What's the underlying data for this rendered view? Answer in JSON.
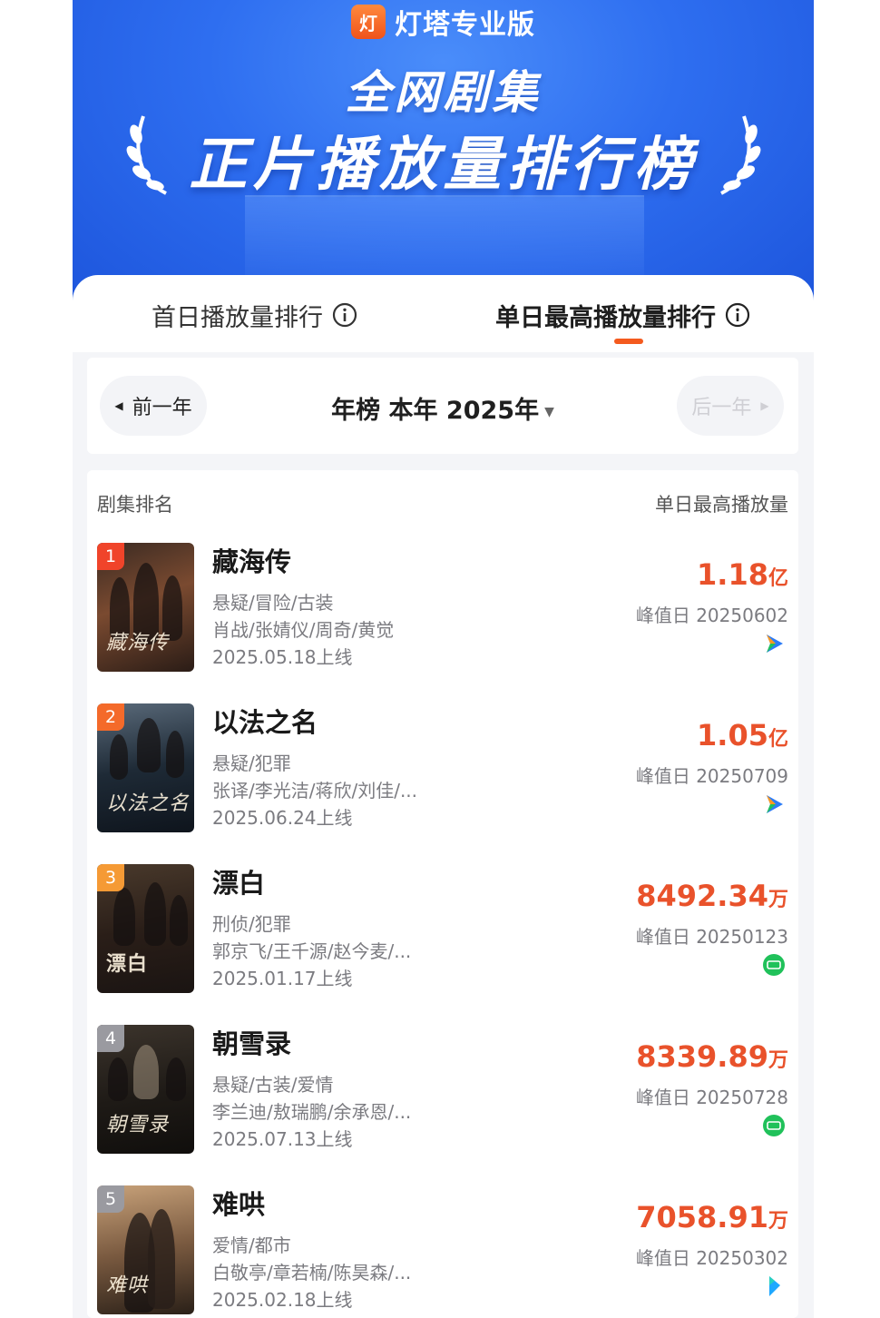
{
  "header": {
    "brand": "灯塔专业版",
    "brand_logo_char": "灯",
    "title_line1": "全网剧集",
    "title_line2": "正片播放量排行榜"
  },
  "tabs": [
    {
      "label": "首日播放量排行",
      "active": false
    },
    {
      "label": "单日最高播放量排行",
      "active": true
    }
  ],
  "year_selector": {
    "prev_label": "前一年",
    "next_label": "后一年",
    "current": "年榜  本年  2025年"
  },
  "list": {
    "col_left": "剧集排名",
    "col_right": "单日最高播放量",
    "items": [
      {
        "rank": "1",
        "name": "藏海传",
        "genre": "悬疑/冒险/古装",
        "cast": "肖战/张婧仪/周奇/黄觉",
        "release": "2025.05.18上线",
        "value": "1.18",
        "unit": "亿",
        "peak": "峰值日 20250602",
        "platform": "tencent-video-icon",
        "poster_text": "藏海传"
      },
      {
        "rank": "2",
        "name": "以法之名",
        "genre": "悬疑/犯罪",
        "cast": "张译/李光洁/蒋欣/刘佳/...",
        "release": "2025.06.24上线",
        "value": "1.05",
        "unit": "亿",
        "peak": "峰值日 20250709",
        "platform": "tencent-video-icon",
        "poster_text": "以法之名"
      },
      {
        "rank": "3",
        "name": "漂白",
        "genre": "刑侦/犯罪",
        "cast": "郭京飞/王千源/赵今麦/...",
        "release": "2025.01.17上线",
        "value": "8492.34",
        "unit": "万",
        "peak": "峰值日 20250123",
        "platform": "iqiyi-icon",
        "poster_text": "漂白"
      },
      {
        "rank": "4",
        "name": "朝雪录",
        "genre": "悬疑/古装/爱情",
        "cast": "李兰迪/敖瑞鹏/余承恩/...",
        "release": "2025.07.13上线",
        "value": "8339.89",
        "unit": "万",
        "peak": "峰值日 20250728",
        "platform": "iqiyi-icon",
        "poster_text": "朝雪录"
      },
      {
        "rank": "5",
        "name": "难哄",
        "genre": "爱情/都市",
        "cast": "白敬亭/章若楠/陈昊森/...",
        "release": "2025.02.18上线",
        "value": "7058.91",
        "unit": "万",
        "peak": "峰值日 20250302",
        "platform": "youku-icon",
        "poster_text": "难哄"
      }
    ]
  },
  "colors": {
    "accent": "#f45a1e",
    "value": "#e9522b",
    "banner_blue": "#2e6ef0",
    "rank1": "#f0442a",
    "rank2": "#f46a2a",
    "rank3": "#f59a35",
    "rank_other": "#9a9aa0",
    "iqiyi_green": "#20c15a"
  }
}
